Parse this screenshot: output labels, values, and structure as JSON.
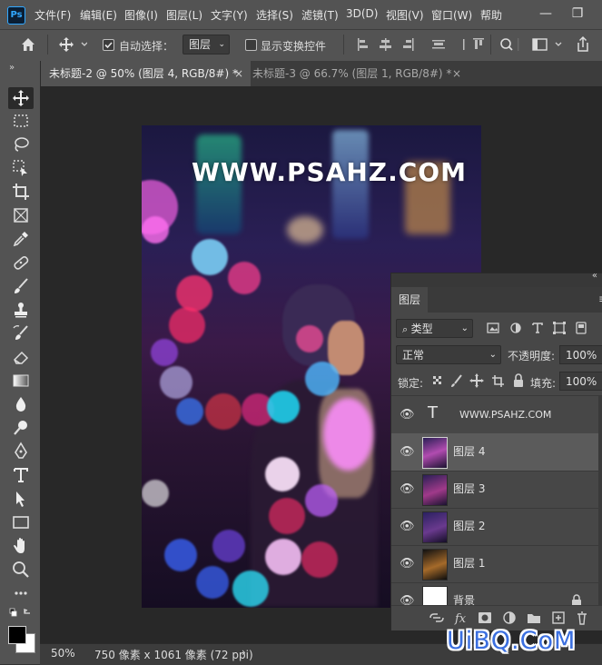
{
  "app": {
    "logo": "Ps"
  },
  "menu": [
    "文件(F)",
    "编辑(E)",
    "图像(I)",
    "图层(L)",
    "文字(Y)",
    "选择(S)",
    "滤镜(T)",
    "3D(D)",
    "视图(V)",
    "窗口(W)",
    "帮助"
  ],
  "window_controls": {
    "minimize": "—",
    "restore": "❐"
  },
  "options": {
    "auto_select_label": "自动选择：",
    "auto_select_value": "图层",
    "show_transform_label": "显示变换控件"
  },
  "tabs": [
    {
      "label": "未标题-2 @ 50% (图层 4, RGB/8#) *",
      "close": "×"
    },
    {
      "label": "未标题-3 @ 66.7% (图层 1, RGB/8#) *",
      "close": "×"
    }
  ],
  "canvas": {
    "watermark_text": "WWW.PSAHZ.COM"
  },
  "status": {
    "zoom": "50%",
    "doc_info": "750 像素 x 1061 像素 (72 ppi)",
    "arrow": "›"
  },
  "layers_panel": {
    "title": "图层",
    "filter_kind": "类型",
    "blend_mode": "正常",
    "opacity_label": "不透明度:",
    "opacity_value": "100%",
    "lock_label": "锁定:",
    "fill_label": "填充:",
    "fill_value": "100%",
    "layers": [
      {
        "name": "WWW.PSAHZ.COM",
        "type": "text",
        "selected": false
      },
      {
        "name": "图层 4",
        "type": "image",
        "selected": true
      },
      {
        "name": "图层 3",
        "type": "image",
        "selected": false
      },
      {
        "name": "图层 2",
        "type": "image",
        "selected": false
      },
      {
        "name": "图层 1",
        "type": "image",
        "selected": false
      },
      {
        "name": "背景",
        "type": "background",
        "selected": false
      }
    ]
  },
  "site_watermark": "UiBQ.CoM",
  "colors": {
    "accent": "#31a8ff",
    "selected_row": "#5b5b5b",
    "watermark_blue": "#3b6fe0"
  }
}
